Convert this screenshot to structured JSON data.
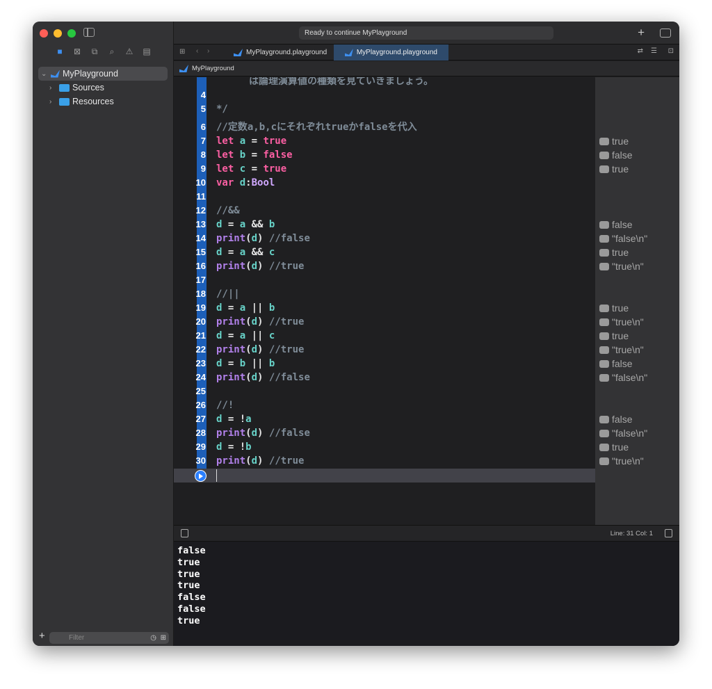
{
  "window": {
    "status": "Ready to continue MyPlayground"
  },
  "tabs": [
    {
      "label": "MyPlayground.playground"
    },
    {
      "label": "MyPlayground.playground",
      "active": true
    }
  ],
  "breadcrumb": "MyPlayground",
  "navigator": {
    "items": [
      {
        "label": "MyPlayground",
        "expanded": true
      },
      {
        "label": "Sources"
      },
      {
        "label": "Resources"
      }
    ],
    "filter_placeholder": "Filter"
  },
  "editor": {
    "partial_line": "は論理演算値の種類を見ていきましょう。",
    "lines": [
      {
        "n": "4",
        "tokens": []
      },
      {
        "n": "5",
        "tokens": [
          {
            "t": "*/",
            "c": "cm"
          }
        ]
      },
      {
        "n": "6",
        "tokens": [
          {
            "t": "//定数a,b,cにそれぞれtrueかfalseを代入",
            "c": "cm"
          }
        ]
      },
      {
        "n": "7",
        "tokens": [
          {
            "t": "let ",
            "c": "kw"
          },
          {
            "t": "a",
            "c": "id"
          },
          {
            "t": " = ",
            "c": "pl"
          },
          {
            "t": "true",
            "c": "kw"
          }
        ],
        "result": "true"
      },
      {
        "n": "8",
        "tokens": [
          {
            "t": "let ",
            "c": "kw"
          },
          {
            "t": "b",
            "c": "id"
          },
          {
            "t": " = ",
            "c": "pl"
          },
          {
            "t": "false",
            "c": "kw"
          }
        ],
        "result": "false"
      },
      {
        "n": "9",
        "tokens": [
          {
            "t": "let ",
            "c": "kw"
          },
          {
            "t": "c",
            "c": "id"
          },
          {
            "t": " = ",
            "c": "pl"
          },
          {
            "t": "true",
            "c": "kw"
          }
        ],
        "result": "true"
      },
      {
        "n": "10",
        "tokens": [
          {
            "t": "var ",
            "c": "kw"
          },
          {
            "t": "d",
            "c": "id"
          },
          {
            "t": ":",
            "c": "pl"
          },
          {
            "t": "Bool",
            "c": "ty"
          }
        ]
      },
      {
        "n": "11",
        "tokens": []
      },
      {
        "n": "12",
        "tokens": [
          {
            "t": "//&&",
            "c": "cm"
          }
        ]
      },
      {
        "n": "13",
        "tokens": [
          {
            "t": "d",
            "c": "id"
          },
          {
            "t": " = ",
            "c": "pl"
          },
          {
            "t": "a",
            "c": "id"
          },
          {
            "t": " && ",
            "c": "pl"
          },
          {
            "t": "b",
            "c": "id"
          }
        ],
        "result": "false"
      },
      {
        "n": "14",
        "tokens": [
          {
            "t": "print",
            "c": "fn"
          },
          {
            "t": "(",
            "c": "pl"
          },
          {
            "t": "d",
            "c": "id"
          },
          {
            "t": ") ",
            "c": "pl"
          },
          {
            "t": "//false",
            "c": "cm"
          }
        ],
        "result": "\"false\\n\""
      },
      {
        "n": "15",
        "tokens": [
          {
            "t": "d",
            "c": "id"
          },
          {
            "t": " = ",
            "c": "pl"
          },
          {
            "t": "a",
            "c": "id"
          },
          {
            "t": " && ",
            "c": "pl"
          },
          {
            "t": "c",
            "c": "id"
          }
        ],
        "result": "true"
      },
      {
        "n": "16",
        "tokens": [
          {
            "t": "print",
            "c": "fn"
          },
          {
            "t": "(",
            "c": "pl"
          },
          {
            "t": "d",
            "c": "id"
          },
          {
            "t": ") ",
            "c": "pl"
          },
          {
            "t": "//true",
            "c": "cm"
          }
        ],
        "result": "\"true\\n\""
      },
      {
        "n": "17",
        "tokens": []
      },
      {
        "n": "18",
        "tokens": [
          {
            "t": "//||",
            "c": "cm"
          }
        ]
      },
      {
        "n": "19",
        "tokens": [
          {
            "t": "d",
            "c": "id"
          },
          {
            "t": " = ",
            "c": "pl"
          },
          {
            "t": "a",
            "c": "id"
          },
          {
            "t": " || ",
            "c": "pl"
          },
          {
            "t": "b",
            "c": "id"
          }
        ],
        "result": "true"
      },
      {
        "n": "20",
        "tokens": [
          {
            "t": "print",
            "c": "fn"
          },
          {
            "t": "(",
            "c": "pl"
          },
          {
            "t": "d",
            "c": "id"
          },
          {
            "t": ") ",
            "c": "pl"
          },
          {
            "t": "//true",
            "c": "cm"
          }
        ],
        "result": "\"true\\n\""
      },
      {
        "n": "21",
        "tokens": [
          {
            "t": "d",
            "c": "id"
          },
          {
            "t": " = ",
            "c": "pl"
          },
          {
            "t": "a",
            "c": "id"
          },
          {
            "t": " || ",
            "c": "pl"
          },
          {
            "t": "c",
            "c": "id"
          }
        ],
        "result": "true"
      },
      {
        "n": "22",
        "tokens": [
          {
            "t": "print",
            "c": "fn"
          },
          {
            "t": "(",
            "c": "pl"
          },
          {
            "t": "d",
            "c": "id"
          },
          {
            "t": ") ",
            "c": "pl"
          },
          {
            "t": "//true",
            "c": "cm"
          }
        ],
        "result": "\"true\\n\""
      },
      {
        "n": "23",
        "tokens": [
          {
            "t": "d",
            "c": "id"
          },
          {
            "t": " = ",
            "c": "pl"
          },
          {
            "t": "b",
            "c": "id"
          },
          {
            "t": " || ",
            "c": "pl"
          },
          {
            "t": "b",
            "c": "id"
          }
        ],
        "result": "false"
      },
      {
        "n": "24",
        "tokens": [
          {
            "t": "print",
            "c": "fn"
          },
          {
            "t": "(",
            "c": "pl"
          },
          {
            "t": "d",
            "c": "id"
          },
          {
            "t": ") ",
            "c": "pl"
          },
          {
            "t": "//false",
            "c": "cm"
          }
        ],
        "result": "\"false\\n\""
      },
      {
        "n": "25",
        "tokens": []
      },
      {
        "n": "26",
        "tokens": [
          {
            "t": "//!",
            "c": "cm"
          }
        ]
      },
      {
        "n": "27",
        "tokens": [
          {
            "t": "d",
            "c": "id"
          },
          {
            "t": " = !",
            "c": "pl"
          },
          {
            "t": "a",
            "c": "id"
          }
        ],
        "result": "false"
      },
      {
        "n": "28",
        "tokens": [
          {
            "t": "print",
            "c": "fn"
          },
          {
            "t": "(",
            "c": "pl"
          },
          {
            "t": "d",
            "c": "id"
          },
          {
            "t": ") ",
            "c": "pl"
          },
          {
            "t": "//false",
            "c": "cm"
          }
        ],
        "result": "\"false\\n\""
      },
      {
        "n": "29",
        "tokens": [
          {
            "t": "d",
            "c": "id"
          },
          {
            "t": " = !",
            "c": "pl"
          },
          {
            "t": "b",
            "c": "id"
          }
        ],
        "result": "true"
      },
      {
        "n": "30",
        "tokens": [
          {
            "t": "print",
            "c": "fn"
          },
          {
            "t": "(",
            "c": "pl"
          },
          {
            "t": "d",
            "c": "id"
          },
          {
            "t": ") ",
            "c": "pl"
          },
          {
            "t": "//true",
            "c": "cm"
          }
        ],
        "result": "\"true\\n\""
      }
    ]
  },
  "debug_bar": {
    "position": "Line: 31  Col: 1"
  },
  "console": [
    "false",
    "true",
    "true",
    "true",
    "false",
    "false",
    "true"
  ],
  "colors": {
    "accent": "#1d5fb8",
    "keyword": "#fc5fa3",
    "close": "#ff5f57",
    "minimize": "#febc2e",
    "zoom": "#28c840"
  }
}
